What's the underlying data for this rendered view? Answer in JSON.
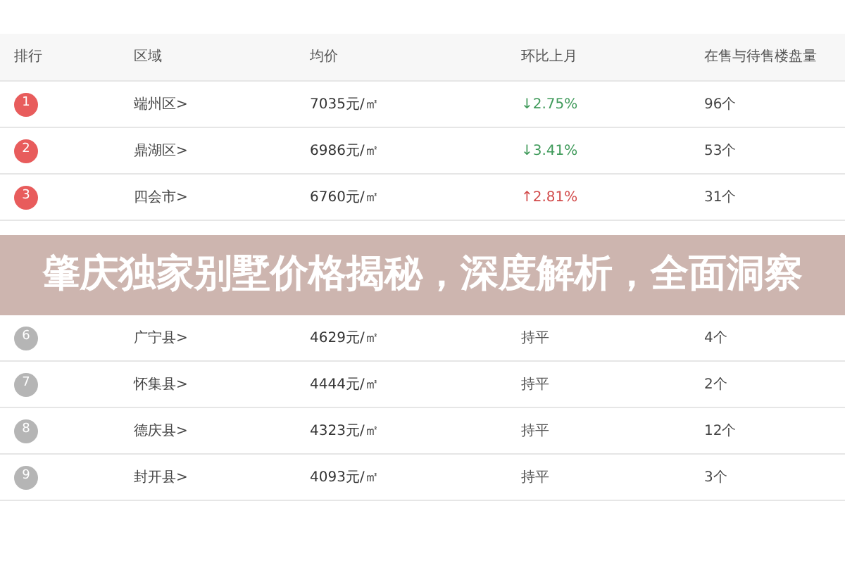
{
  "table": {
    "columns": [
      "排行",
      "区域",
      "均价",
      "环比上月",
      "在售与待售楼盘量"
    ],
    "rows": [
      {
        "rank": "1",
        "color": "#e85c5c",
        "region": "端州区>",
        "price": "7035元/㎡",
        "change": "↓2.75%",
        "kind": "down",
        "count": "96个"
      },
      {
        "rank": "2",
        "color": "#e85c5c",
        "region": "鼎湖区>",
        "price": "6986元/㎡",
        "change": "↓3.41%",
        "kind": "down",
        "count": "53个"
      },
      {
        "rank": "3",
        "color": "#e85c5c",
        "region": "四会市>",
        "price": "6760元/㎡",
        "change": "↑2.81%",
        "kind": "up",
        "count": "31个"
      }
    ]
  },
  "banner": {
    "title": "肇庆独家别墅价格揭秘，深度解析，全面洞察"
  },
  "table_below_banner": {
    "rows": [
      {
        "rank": "6",
        "color": "#b5b5b5",
        "region": "广宁县>",
        "price": "4629元/㎡",
        "change": "持平",
        "kind": "flat",
        "count": "4个"
      },
      {
        "rank": "7",
        "color": "#b5b5b5",
        "region": "怀集县>",
        "price": "4444元/㎡",
        "change": "持平",
        "kind": "flat",
        "count": "2个"
      },
      {
        "rank": "8",
        "color": "#b5b5b5",
        "region": "德庆县>",
        "price": "4323元/㎡",
        "change": "持平",
        "kind": "flat",
        "count": "12个"
      },
      {
        "rank": "9",
        "color": "#b5b5b5",
        "region": "封开县>",
        "price": "4093元/㎡",
        "change": "持平",
        "kind": "flat",
        "count": "3个"
      }
    ]
  }
}
